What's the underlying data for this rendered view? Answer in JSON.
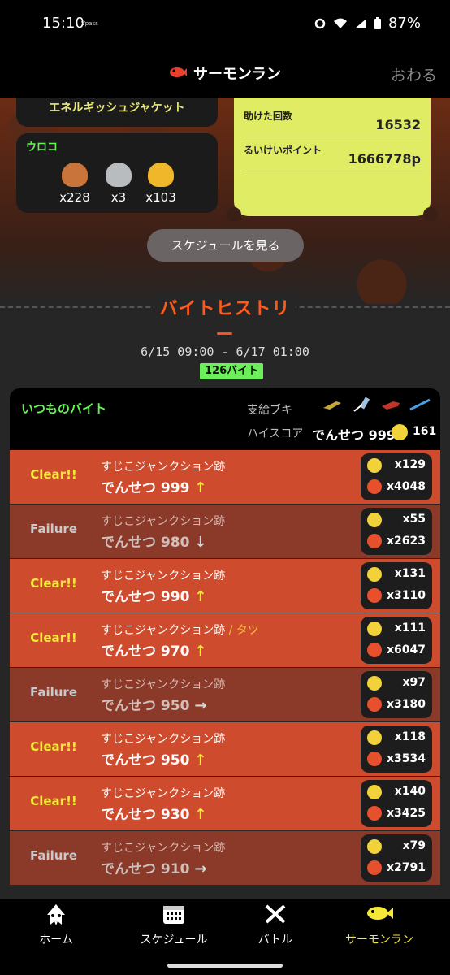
{
  "status_bar": {
    "time": "15:10",
    "carrier_tag": "Vpass",
    "battery": "87%"
  },
  "header": {
    "title": "サーモンラン",
    "close_label": "おわる"
  },
  "top": {
    "jacket_name": "エネルギッシュジャケット",
    "scales": {
      "label": "ウロコ",
      "items": [
        {
          "name": "bronze-scale",
          "count": "x228",
          "color": "#c8743a"
        },
        {
          "name": "silver-scale",
          "count": "x3",
          "color": "#b9bcbf"
        },
        {
          "name": "gold-scale",
          "count": "x103",
          "color": "#f1b72b"
        }
      ]
    },
    "stats": [
      {
        "label": "助けた回数",
        "value": "16532"
      },
      {
        "label": "るいけいポイント",
        "value": "1666778p"
      }
    ],
    "schedule_button": "スケジュールを見る"
  },
  "history": {
    "title": "バイトヒストリー",
    "period": "6/15 09:00 - 6/17 01:00",
    "count_badge": "126バイト",
    "summary": {
      "label": "いつものバイト",
      "weapons_label": "支給ブキ",
      "highscore_label": "ハイスコア",
      "highscore_rank": "でんせつ 999",
      "highscore_eggs": "161"
    },
    "rows": [
      {
        "result": "Clear!!",
        "stage": "すじこジャンクション跡",
        "boss": "",
        "rank": "でんせつ 999",
        "trend": "↑",
        "golden": "x129",
        "power": "x4048",
        "status": "clear"
      },
      {
        "result": "Failure",
        "stage": "すじこジャンクション跡",
        "boss": "",
        "rank": "でんせつ 980",
        "trend": "↓",
        "golden": "x55",
        "power": "x2623",
        "status": "failure"
      },
      {
        "result": "Clear!!",
        "stage": "すじこジャンクション跡",
        "boss": "",
        "rank": "でんせつ 990",
        "trend": "↑",
        "golden": "x131",
        "power": "x3110",
        "status": "clear"
      },
      {
        "result": "Clear!!",
        "stage": "すじこジャンクション跡",
        "boss": " / タツ",
        "rank": "でんせつ 970",
        "trend": "↑",
        "golden": "x111",
        "power": "x6047",
        "status": "clear"
      },
      {
        "result": "Failure",
        "stage": "すじこジャンクション跡",
        "boss": "",
        "rank": "でんせつ 950",
        "trend": "→",
        "golden": "x97",
        "power": "x3180",
        "status": "failure"
      },
      {
        "result": "Clear!!",
        "stage": "すじこジャンクション跡",
        "boss": "",
        "rank": "でんせつ 950",
        "trend": "↑",
        "golden": "x118",
        "power": "x3534",
        "status": "clear"
      },
      {
        "result": "Clear!!",
        "stage": "すじこジャンクション跡",
        "boss": "",
        "rank": "でんせつ 930",
        "trend": "↑",
        "golden": "x140",
        "power": "x3425",
        "status": "clear"
      },
      {
        "result": "Failure",
        "stage": "すじこジャンクション跡",
        "boss": "",
        "rank": "でんせつ 910",
        "trend": "→",
        "golden": "x79",
        "power": "x2791",
        "status": "failure"
      }
    ]
  },
  "nav": {
    "items": [
      {
        "label": "ホーム",
        "icon": "squid-icon"
      },
      {
        "label": "スケジュール",
        "icon": "calendar-icon"
      },
      {
        "label": "バトル",
        "icon": "crossed-weapons-icon"
      },
      {
        "label": "サーモンラン",
        "icon": "salmon-icon"
      }
    ],
    "active": 3
  },
  "colors": {
    "clear_row": "#ce4b2d",
    "failure_row": "#8b3a2a",
    "accent_yellow": "#f4e83a",
    "accent_green": "#6cf05a",
    "stats_card": "#e1ec65"
  }
}
